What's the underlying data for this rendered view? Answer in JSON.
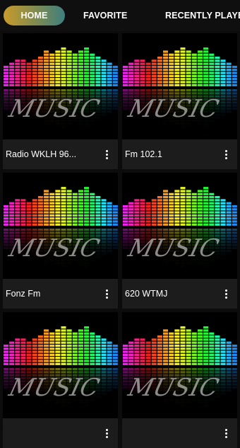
{
  "tabs": [
    {
      "label": "HOME",
      "active": true
    },
    {
      "label": "FAVORITE",
      "active": false
    },
    {
      "label": "RECENTLY PLAYED",
      "active": false
    }
  ],
  "art": {
    "watermark": "MUSIC"
  },
  "stations": [
    {
      "title": "Radio WKLH 96..."
    },
    {
      "title": "Fm 102.1"
    },
    {
      "title": "Fonz Fm"
    },
    {
      "title": "620 WTMJ"
    },
    {
      "title": ""
    },
    {
      "title": ""
    }
  ],
  "colors": {
    "tab_active_start": "#c99a2c",
    "tab_active_end": "#3d7f7e",
    "card_bg": "#1c1c1c"
  },
  "icons": {
    "card_menu": "more-vert-icon"
  }
}
